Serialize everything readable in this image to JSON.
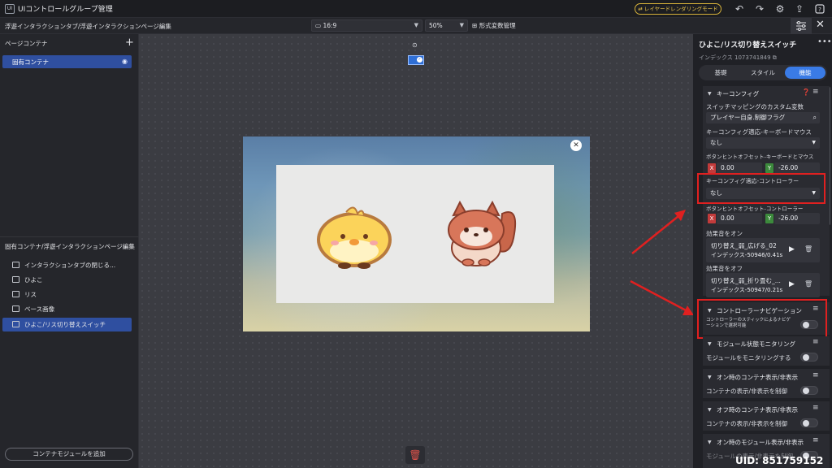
{
  "titlebar": {
    "app_icon_text": "UI",
    "title": "UIコントロールグループ管理",
    "layer_mode_button": "⇄ レイヤードレンダリングモード",
    "icons": [
      "undo-icon",
      "redo-icon",
      "settings-icon",
      "export-icon",
      "help-icon"
    ]
  },
  "toolbar": {
    "breadcrumb": "浮遊インタラクションタブ/浮遊インタラクションページ編集",
    "aspect_ratio": "16:9",
    "zoom": "50%",
    "format_button": "形式変数管理"
  },
  "left_panel": {
    "page_container_title": "ページコンテナ",
    "container_item": "固有コンテナ",
    "edit_title": "固有コンテナ/浮遊インタラクションページ編集",
    "tree_items": [
      {
        "label": "インタラクションタブの閉じる..."
      },
      {
        "label": "ひよこ"
      },
      {
        "label": "リス"
      },
      {
        "label": "ベース画像"
      },
      {
        "label": "ひよこ/リス切り替えスイッチ",
        "selected": true
      }
    ],
    "add_module_button": "コンテナモジュールを追加"
  },
  "canvas": {
    "preview_close": "✕"
  },
  "right_panel": {
    "title": "ひよこ/リス切り替えスイッチ",
    "index_label": "インデックス 1073741849",
    "tabs": [
      "基礎",
      "スタイル",
      "機能"
    ],
    "active_tab": "機能",
    "key_config": {
      "header": "キーコンフィグ",
      "custom_var_label": "スイッチマッピングのカスタム変数",
      "custom_var_value": "プレイヤー自身.制御フラグ",
      "kb_mouse_label": "キーコンフィグ適応-キーボードマウス",
      "kb_mouse_value": "なし",
      "kb_offset_label": "ボタンヒントオフセット-キーボードとマウス",
      "kb_offset_x": "0.00",
      "kb_offset_y": "-26.00",
      "controller_label": "キーコンフィグ適応-コントローラー",
      "controller_value": "なし",
      "ctrl_offset_label": "ボタンヒントオフセット-コントローラー",
      "ctrl_offset_x": "0.00",
      "ctrl_offset_y": "-26.00",
      "sound_on_label": "効果音をオン",
      "sound_on_name": "切り替え_弱_広げる_02",
      "sound_on_index": "インデックス-50946/0.41s",
      "sound_off_label": "効果音をオフ",
      "sound_off_name": "切り替え_弱_折り畳む_...",
      "sound_off_index": "インデックス-50947/0.21s"
    },
    "controller_nav": {
      "header": "コントローラーナビゲーション",
      "desc": "コントローラーのスティックによるナビゲーションで選択可能"
    },
    "module_monitor": {
      "header": "モジュール状態モニタリング",
      "toggle_label": "モジュールをモニタリングする"
    },
    "on_container": {
      "header": "オン時のコンテナ表示/非表示",
      "toggle_label": "コンテナの表示/非表示を制御"
    },
    "off_container": {
      "header": "オフ時のコンテナ表示/非表示",
      "toggle_label": "コンテナの表示/非表示を制御"
    },
    "on_module": {
      "header": "オン時のモジュール表示/非表示",
      "toggle_label": "モジュールの表示/非表示を制御"
    }
  },
  "watermark": "UID: 851759152",
  "colors": {
    "accent_blue": "#3a7be6",
    "selection_blue": "#2f4fa0",
    "highlight_red": "#e02020",
    "layer_mode_gold": "#e9c44a"
  }
}
